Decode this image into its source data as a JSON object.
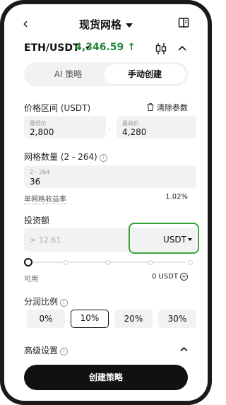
{
  "header": {
    "back_icon": "chevron-left-icon",
    "title": "现货网格",
    "book_icon": "book-icon"
  },
  "pair": {
    "symbol": "ETH/USDT",
    "price": "4,346.59",
    "price_color": "#238636",
    "direction_icon": "arrow-up-icon",
    "chart_icon": "candlestick-icon",
    "collapse_icon": "chevron-up-icon"
  },
  "tabs": [
    {
      "label": "AI 策略",
      "active": false
    },
    {
      "label": "手动创建",
      "active": true
    }
  ],
  "price_range": {
    "label": "价格区间 (USDT)",
    "clear_label": "清除参数",
    "min_caption": "最低价",
    "min_value": "2,800",
    "separator": "-",
    "max_caption": "最高价",
    "max_value": "4,280"
  },
  "grid": {
    "label": "网格数量 (2 - 264)",
    "range_caption": "2 - 264",
    "value": "36",
    "yield_label": "单网格收益率",
    "yield_value": "1.02%"
  },
  "investment": {
    "label": "投资额",
    "placeholder": "> 12.61",
    "unit": "USDT",
    "highlight_color": "#38a33a",
    "slider_fraction": 0,
    "available_label": "可用",
    "available_value": "0 USDT"
  },
  "split": {
    "label": "分润比例",
    "options": [
      "0%",
      "10%",
      "20%",
      "30%"
    ],
    "selected": "10%"
  },
  "advanced": {
    "label": "高级设置"
  },
  "create_button": {
    "label": "创建策略"
  }
}
